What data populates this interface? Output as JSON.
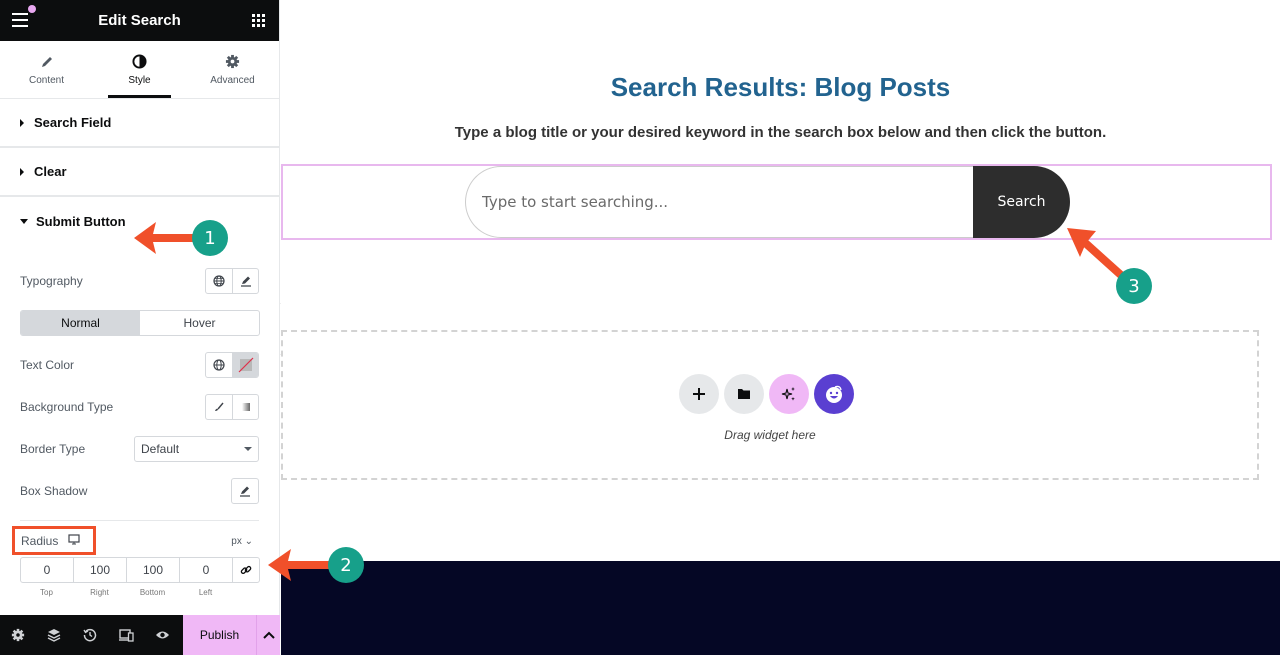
{
  "sidebar": {
    "title": "Edit Search",
    "tabs": [
      {
        "label": "Content",
        "icon": "pencil-icon"
      },
      {
        "label": "Style",
        "icon": "contrast-icon",
        "active": true
      },
      {
        "label": "Advanced",
        "icon": "gear-icon"
      }
    ],
    "sections": [
      {
        "label": "Search Field",
        "open": false
      },
      {
        "label": "Clear",
        "open": false
      },
      {
        "label": "Submit Button",
        "open": true
      }
    ],
    "controls": {
      "typography": "Typography",
      "state_tabs": [
        "Normal",
        "Hover"
      ],
      "active_state": "Normal",
      "text_color": "Text Color",
      "background_type": "Background Type",
      "border_type": "Border Type",
      "border_type_value": "Default",
      "box_shadow": "Box Shadow",
      "radius": "Radius",
      "radius_unit": "px ⌄",
      "radius_values": {
        "top": "0",
        "right": "100",
        "bottom": "100",
        "left": "0"
      },
      "radius_labels": [
        "Top",
        "Right",
        "Bottom",
        "Left"
      ]
    },
    "footer": {
      "publish": "Publish"
    }
  },
  "canvas": {
    "title": "Search Results: Blog Posts",
    "subtitle": "Type a blog title or your desired keyword in the search box below and then click the button.",
    "search_placeholder": "Type to start searching...",
    "search_button": "Search",
    "dropzone_text": "Drag widget here"
  },
  "annotations": [
    "1",
    "2",
    "3"
  ],
  "colors": {
    "accent_pink": "#f0b8f6",
    "title_blue": "#22638f",
    "annotation_arrow": "#f0502a",
    "annotation_badge": "#17a08a",
    "footer_navy": "#050725",
    "ai_purple": "#5a3fd1"
  }
}
